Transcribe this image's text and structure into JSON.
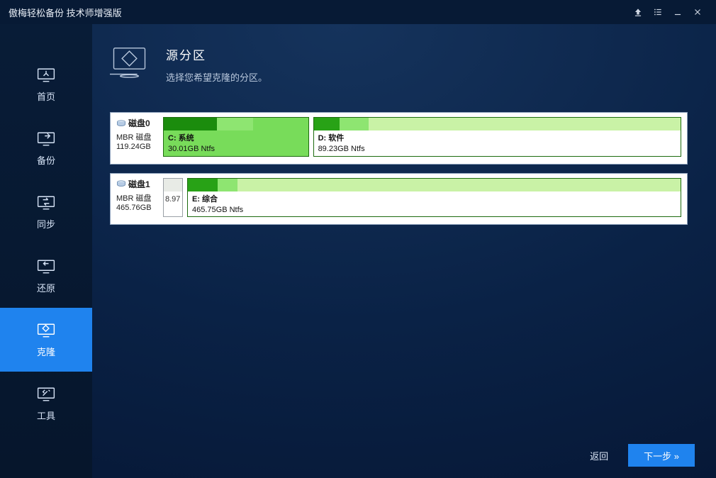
{
  "window": {
    "title": "傲梅轻松备份 技术师增强版"
  },
  "sidebar": {
    "items": [
      {
        "label": "首页"
      },
      {
        "label": "备份"
      },
      {
        "label": "同步"
      },
      {
        "label": "还原"
      },
      {
        "label": "克隆"
      },
      {
        "label": "工具"
      }
    ],
    "active_index": 4
  },
  "page": {
    "title": "源分区",
    "subtitle": "选择您希望克隆的分区。"
  },
  "disks": [
    {
      "name": "磁盘0",
      "type": "MBR 磁盘",
      "size": "119.24GB",
      "partitions": [
        {
          "label": "C: 系统",
          "info": "30.01GB Ntfs",
          "selected": true,
          "flex": 155,
          "used_dark_pct": 37,
          "used_light_pct": 62
        },
        {
          "label": "D: 软件",
          "info": "89.23GB Ntfs",
          "selected": false,
          "flex": 394,
          "used_dark_pct": 7,
          "used_light_pct": 15
        }
      ]
    },
    {
      "name": "磁盘1",
      "type": "MBR 磁盘",
      "size": "465.76GB",
      "small_partition": {
        "label": "8.97"
      },
      "partitions": [
        {
          "label": "E: 综合",
          "info": "465.75GB Ntfs",
          "selected": false,
          "flex": 520,
          "used_dark_pct": 6,
          "used_light_pct": 10
        }
      ]
    }
  ],
  "footer": {
    "back": "返回",
    "next": "下一步 »"
  }
}
